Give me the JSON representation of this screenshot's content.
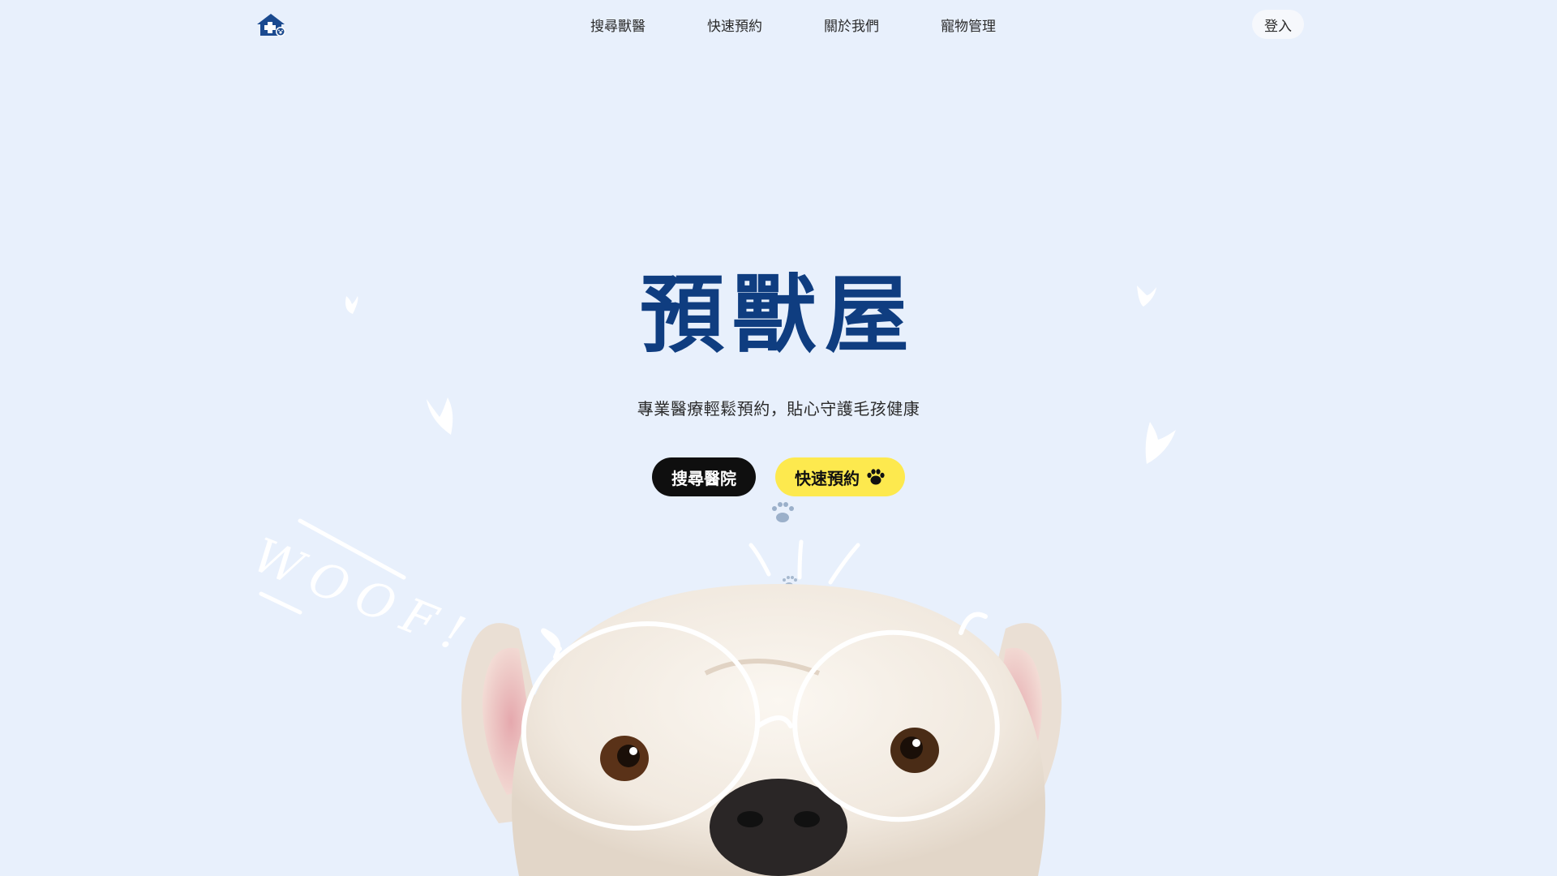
{
  "nav": {
    "logo_icon": "pet-clinic-house-icon",
    "links": [
      {
        "label": "搜尋獸醫"
      },
      {
        "label": "快速預約"
      },
      {
        "label": "關於我們"
      },
      {
        "label": "寵物管理"
      }
    ],
    "login_label": "登入"
  },
  "hero": {
    "title": "預獸屋",
    "subtitle": "專業醫療輕鬆預約，貼心守護毛孩健康",
    "primary_button": "搜尋醫院",
    "secondary_button": "快速預約",
    "secondary_button_icon": "paw-icon",
    "doodle_text": "WOOF!"
  },
  "colors": {
    "background": "#e8f0fc",
    "title": "#0f3d80",
    "dark_button": "#0f0f0f",
    "yellow_button": "#fde94e",
    "logo": "#1b4a8f"
  }
}
